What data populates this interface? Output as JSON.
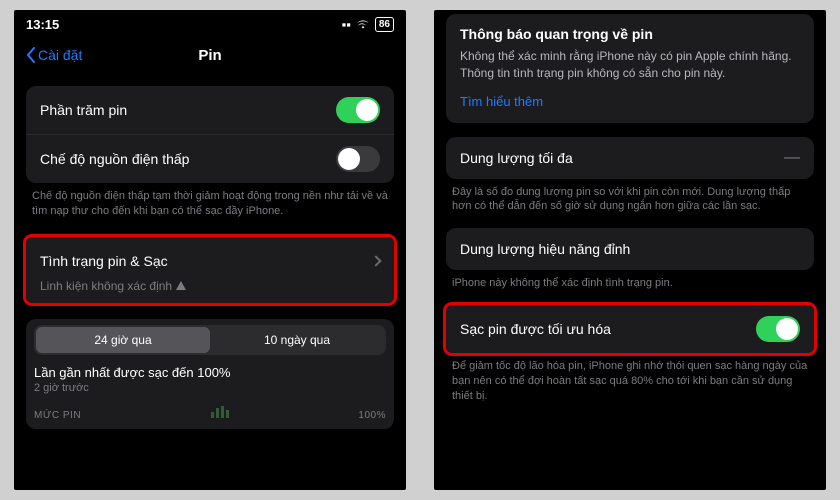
{
  "left": {
    "status": {
      "time": "13:15",
      "battery": "86"
    },
    "nav": {
      "back": "Cài đặt",
      "title": "Pin"
    },
    "rows": {
      "percent": "Phần trăm pin",
      "lowpower": "Chế độ nguồn điện thấp"
    },
    "lowpower_note": "Chế độ nguồn điện thấp tạm thời giảm hoạt động trong nền như tải về và tìm nạp thư cho đến khi bạn có thể sạc đầy iPhone.",
    "health": {
      "label": "Tình trạng pin & Sạc",
      "sub": "Linh kiện không xác định"
    },
    "seg": {
      "a": "24 giờ qua",
      "b": "10 ngày qua"
    },
    "lastcharge": "Lần gần nhất được sạc đến 100%",
    "lastcharge_sub": "2 giờ trước",
    "mucpin": "MỨC PIN",
    "hundred": "100%"
  },
  "right": {
    "notice": {
      "title": "Thông báo quan trọng về pin",
      "body": "Không thể xác minh rằng iPhone này có pin Apple chính hãng. Thông tin tình trạng pin không có sẵn cho pin này.",
      "link": "Tìm hiểu thêm"
    },
    "maxcap": "Dung lượng tối đa",
    "maxcap_note": "Đây là số đo dung lượng pin so với khi pin còn mới. Dung lượng thấp hơn có thể dẫn đến số giờ sử dụng ngắn hơn giữa các lần sạc.",
    "peak": "Dung lượng hiệu năng đỉnh",
    "peak_note": "iPhone này không thể xác định tình trạng pin.",
    "opt": "Sạc pin được tối ưu hóa",
    "opt_note": "Để giảm tốc độ lão hóa pin, iPhone ghi nhớ thói quen sạc hàng ngày của bạn nên có thể đợi hoàn tất sạc quá 80% cho tới khi bạn cần sử dụng thiết bị."
  }
}
